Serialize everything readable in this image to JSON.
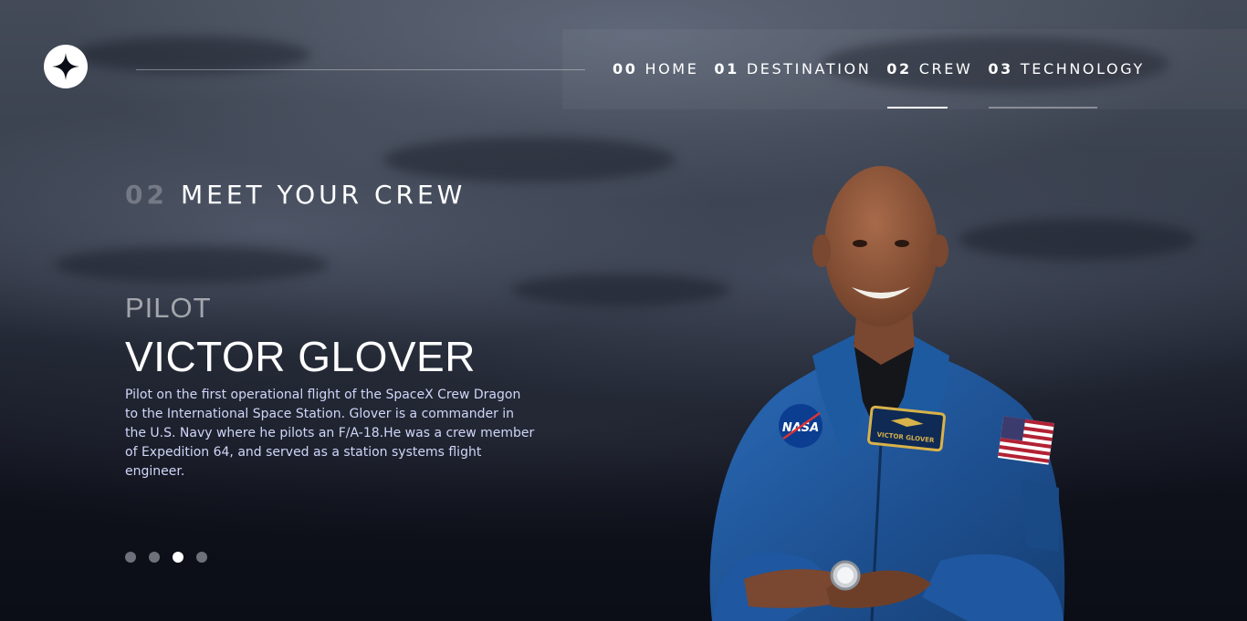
{
  "theme": {
    "background": "#0b0d17",
    "text": "#ffffff",
    "muted": "#d0d6f9",
    "dot_inactive": "#6e717b",
    "dot_active": "#ffffff",
    "underline_active": "#ffffff",
    "underline_hover": "#8a8d96"
  },
  "header": {
    "logo_icon": "four-point-star-icon",
    "nav": [
      {
        "num": "00",
        "label": "HOME"
      },
      {
        "num": "01",
        "label": "DESTINATION"
      },
      {
        "num": "02",
        "label": "CREW",
        "active": true
      },
      {
        "num": "03",
        "label": "TECHNOLOGY",
        "hover": true
      }
    ]
  },
  "page": {
    "heading_num": "02",
    "heading": "MEET YOUR CREW"
  },
  "crew": {
    "role": "PILOT",
    "name": "VICTOR GLOVER",
    "bio": "Pilot on the first operational flight of the SpaceX Crew Dragon to the International Space Station. Glover is a commander in the U.S. Navy where he pilots an F/A-18.He was a crew member of Expedition 64, and served as a station systems flight engineer.",
    "patches": {
      "agency": "NASA",
      "name_tag": "VICTOR GLOVER"
    },
    "pagination": {
      "total": 4,
      "active_index": 2
    }
  }
}
